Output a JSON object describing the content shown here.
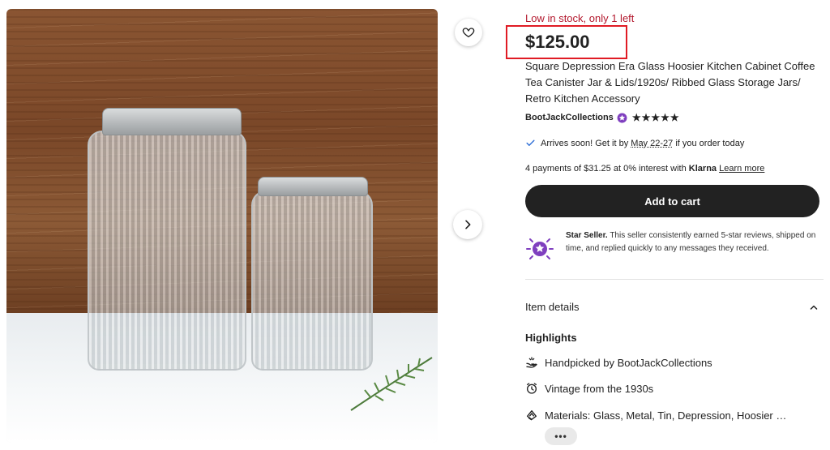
{
  "listing": {
    "stock_text": "Low in stock, only 1 left",
    "price": "$125.00",
    "title": "Square Depression Era Glass Hoosier Kitchen Cabinet Coffee Tea Canister Jar & Lids/1920s/ Ribbed Glass Storage Jars/ Retro Kitchen Accessory",
    "shop_name": "BootJackCollections",
    "rating_stars": "★★★★★",
    "arrival_prefix": "Arrives soon! Get it by",
    "arrival_date": "May 22-27",
    "arrival_suffix": "if you order today",
    "payments_prefix": "4 payments of $31.25 at 0% interest with",
    "payments_brand": "Klarna",
    "payments_link": "Learn more",
    "add_to_cart": "Add to cart"
  },
  "star_seller": {
    "title": "Star Seller.",
    "text": "This seller consistently earned 5-star reviews, shipped on time, and replied quickly to any messages they received."
  },
  "details": {
    "section_title": "Item details",
    "highlights_title": "Highlights",
    "handpicked_prefix": "Handpicked by",
    "handpicked_shop": "BootJackCollections",
    "vintage": "Vintage from the 1930s",
    "materials": "Materials: Glass, Metal, Tin, Depression, Hoosier …",
    "more_label": "•••"
  },
  "colors": {
    "stock": "#b3182d",
    "highlight_box": "#e01b24",
    "cart_button": "#222222",
    "star_seller_badge": "#7f3fbf"
  },
  "icons": [
    "heart-icon",
    "chevron-right-icon",
    "check-icon",
    "star-seller-badge-icon",
    "chevron-up-icon",
    "hand-icon",
    "alarm-clock-icon",
    "materials-icon"
  ]
}
